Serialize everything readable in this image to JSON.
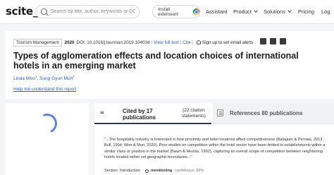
{
  "header": {
    "logo": "scite_",
    "search_placeholder": "Search by title, author, keywords or DOI",
    "install_label": "Install extension!",
    "nav": [
      "Assistant",
      "Product",
      "Solutions",
      "Pricing",
      "Log"
    ]
  },
  "article": {
    "category": "Tourism Management",
    "year": "2020",
    "doi": "DOI: 10.1016/j.tourman.2019.104034",
    "view_full_text": "View full text",
    "cite": "Cite",
    "alert": "Sign up to set email alerts",
    "title": "Types of agglomeration effects and location choices of international hotels in an emerging market",
    "authors": [
      {
        "name": "Linda Woo",
        "sup": "1"
      },
      {
        "name": "Sung Gyun Mun",
        "sup": "2"
      }
    ],
    "help": "Help me understand this report"
  },
  "social": [
    "twitter-icon",
    "facebook-icon",
    "linkedin-icon"
  ],
  "citations": {
    "cited_by": "Cited by 17 publications",
    "citation_statements": "(22 citation statements)",
    "references": "References 80 publications",
    "excerpt": {
      "part1": "\"...The hospitality industry is interested in how proximity and hotel locations affect competitiveness (Balaguer & Pernias, 2013; Bull, 1994; Woo & Mun, 2020). Prior studies on competition within the hotel sector have been limited to establishments within a similar class or position in the market (Baum & Mezias, 1992), capturing an overall scope of competition between neighboring hotels located within set geographic boundaries...\""
    },
    "section_label": "Section:",
    "section": "Introduction",
    "mentioning": "mentioning",
    "confidence": "confidence: 99%"
  }
}
